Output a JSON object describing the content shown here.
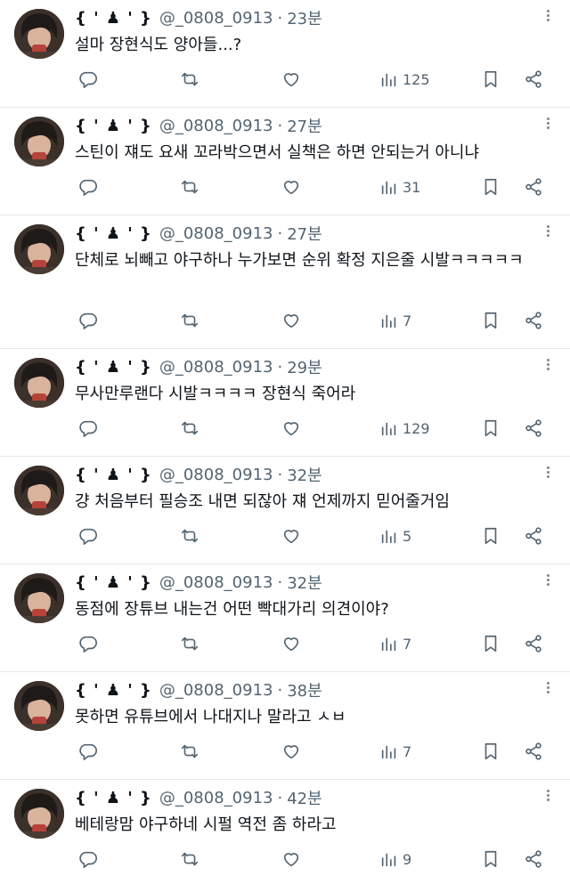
{
  "author": {
    "name": "{ ' ♟ ' }",
    "handle": "@_0808_0913"
  },
  "separator": "·",
  "tweets": [
    {
      "time": "23분",
      "text": "설마 장현식도 양아들...?",
      "views": "125"
    },
    {
      "time": "27분",
      "text": "스틴이 쟤도 요새 꼬라박으면서 실책은 하면 안되는거 아니냐",
      "views": "31"
    },
    {
      "time": "27분",
      "text": "단체로 뇌빼고 야구하나 누가보면 순위 확정 지은줄 시발ㅋㅋㅋㅋㅋ",
      "views": "7"
    },
    {
      "time": "29분",
      "text": "무사만루랜다 시발ㅋㅋㅋㅋ 장현식 죽어라",
      "views": "129"
    },
    {
      "time": "32분",
      "text": "걍 처음부터 필승조 내면 되잖아 쟤 언제까지 믿어줄거임",
      "views": "5"
    },
    {
      "time": "32분",
      "text": "동점에 장튜브 내는건 어떤 빡대가리 의견이야?",
      "views": "7"
    },
    {
      "time": "38분",
      "text": "못하면 유튜브에서 나대지나 말라고 ㅅㅂ",
      "views": "7"
    },
    {
      "time": "42분",
      "text": "베테랑맘 야구하네 시펄 역전 좀 하라고",
      "views": "9"
    }
  ],
  "icons": {
    "reply": "reply-icon",
    "retweet": "retweet-icon",
    "like": "heart-icon",
    "views": "views-icon",
    "bookmark": "bookmark-icon",
    "share": "share-icon",
    "more": "more-icon"
  },
  "colors": {
    "text": "#0f1419",
    "muted": "#536471",
    "divider": "#e6e9ec"
  }
}
